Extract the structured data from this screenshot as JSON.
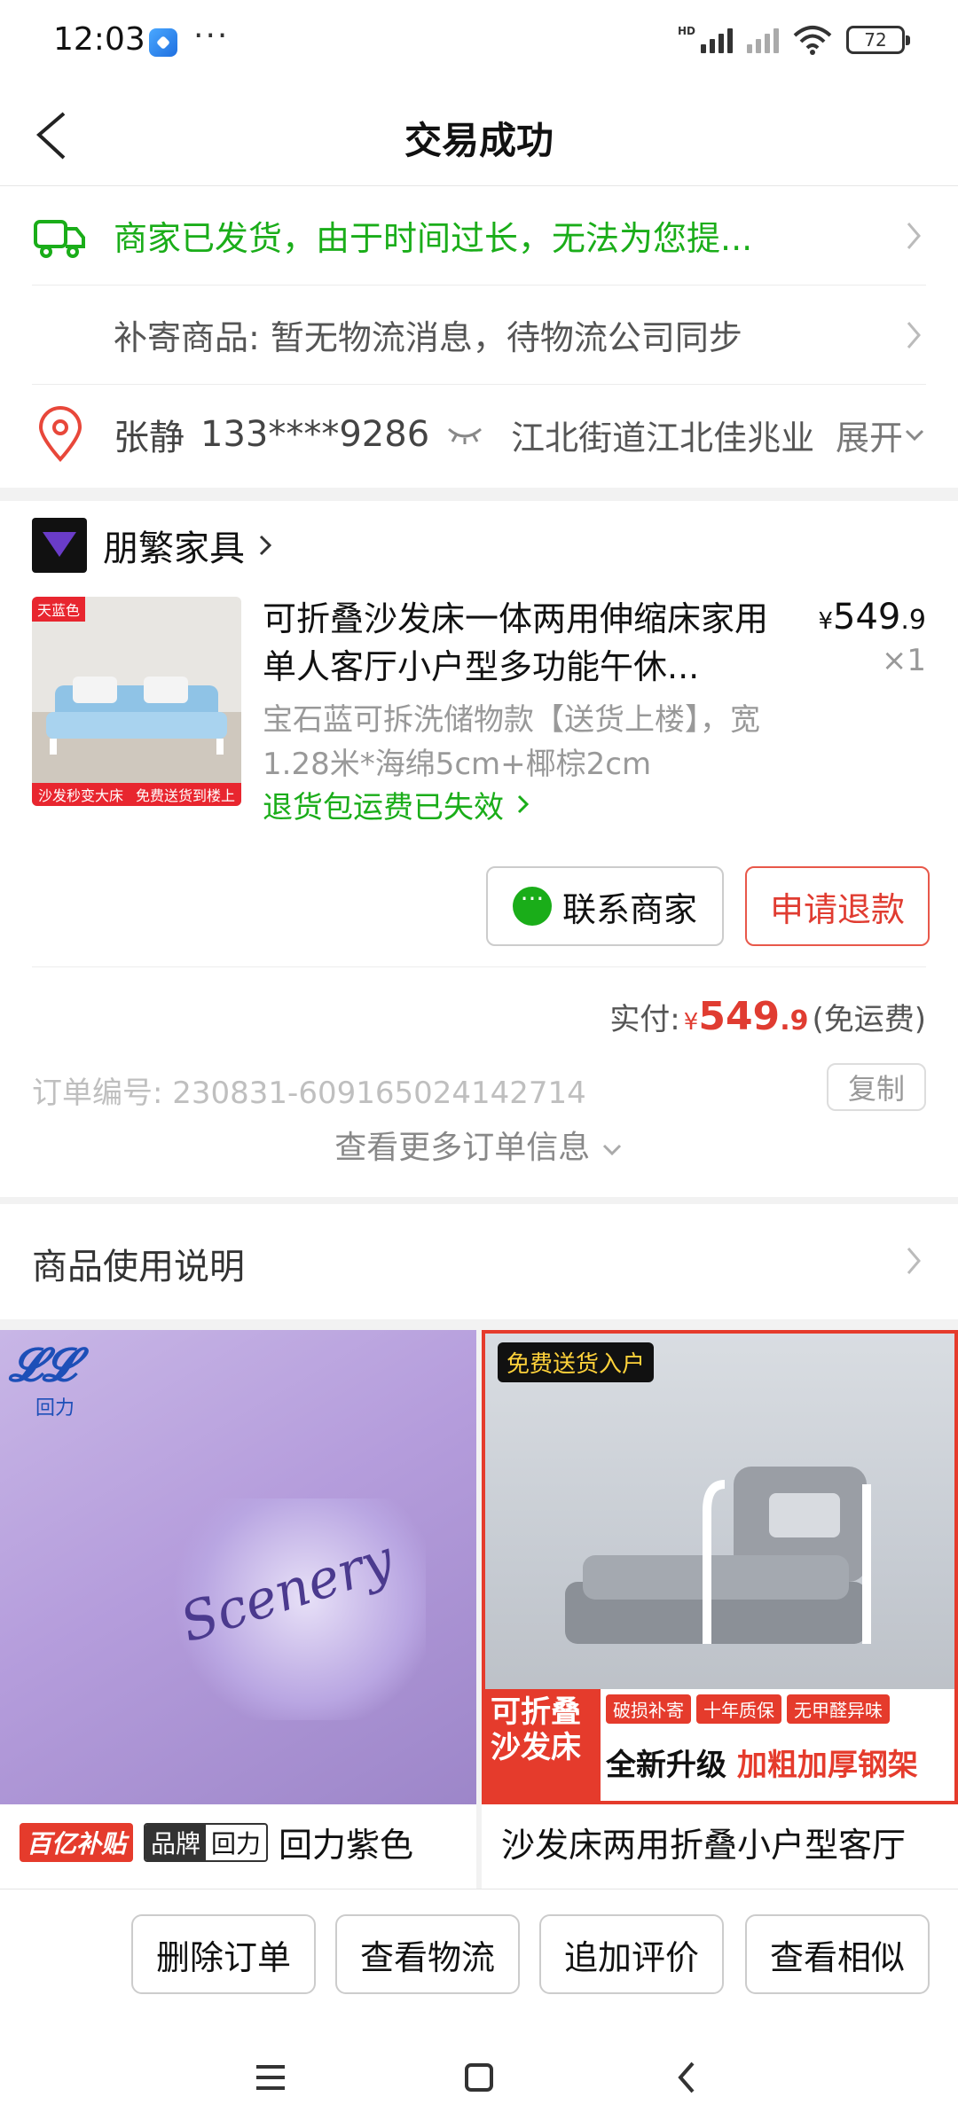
{
  "status_bar": {
    "time": "12:03",
    "dots": "···",
    "hd": "HD",
    "battery": "72"
  },
  "header": {
    "title": "交易成功"
  },
  "logistics": {
    "status": "商家已发货，由于时间过长，无法为您提...",
    "reship": "补寄商品: 暂无物流消息，待物流公司同步"
  },
  "address": {
    "name": "张静",
    "phone": "133****9286",
    "text": "江北街道江北佳兆业",
    "expand": "展开"
  },
  "shop": {
    "name": "朋繁家具"
  },
  "product": {
    "title": "可折叠沙发床一体两用伸缩床家用单人客厅小户型多功能午休...",
    "price_symbol": "¥",
    "price_int": "549",
    "price_dec": ".9",
    "qty": "×1",
    "spec": "宝石蓝可拆洗储物款【送货上楼】，宽1.28米*海绵5cm+椰棕2cm",
    "refund_note": "退货包运费已失效",
    "img_tag_top": "天蓝色",
    "img_tag_bottom_1": "沙发秒变大床",
    "img_tag_bottom_2": "免费送货到楼上"
  },
  "buttons": {
    "contact": "联系商家",
    "refund": "申请退款"
  },
  "payment": {
    "label": "实付:",
    "symbol": "¥",
    "int": "549",
    "dec": ".9",
    "note": "(免运费)"
  },
  "order": {
    "number": "订单编号: 230831-609165024142714",
    "copy": "复制",
    "more": "查看更多订单信息"
  },
  "usage": {
    "label": "商品使用说明"
  },
  "recommendations": [
    {
      "brand_logo": "回力",
      "tag_subsidy": "百亿补贴",
      "tag_brand_label": "品牌",
      "tag_brand_name": "回力",
      "title": "回力紫色",
      "print_text": "Scenery"
    },
    {
      "top_tag": "免费送货入户",
      "banner_left": "可折叠沙发床",
      "badges": [
        "破损补寄",
        "十年质保",
        "无甲醛异味"
      ],
      "banner_main_1": "全新升级",
      "banner_main_2": "加粗加厚钢架",
      "title": "沙发床两用折叠小户型客厅"
    }
  ],
  "actions": {
    "delete": "删除订单",
    "logistics": "查看物流",
    "review": "追加评价",
    "similar": "查看相似"
  },
  "colors": {
    "green": "#1aad19",
    "red": "#e03c31"
  }
}
